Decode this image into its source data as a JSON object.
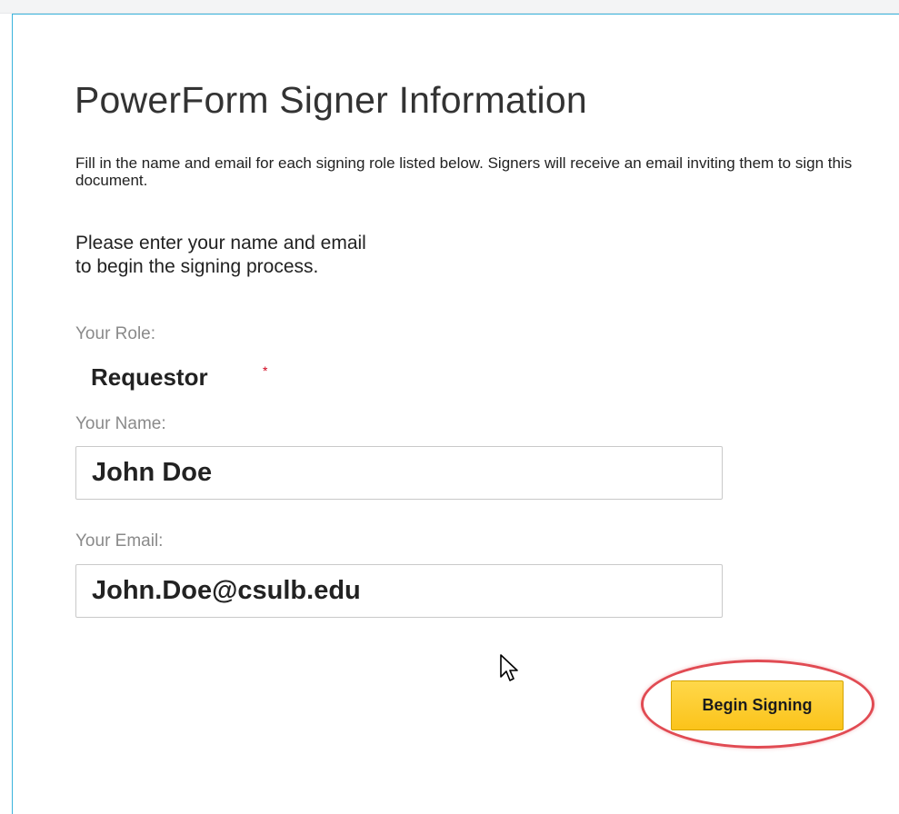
{
  "page": {
    "title": "PowerForm Signer Information",
    "intro": "Fill in the name and email for each signing role listed below. Signers will receive an email inviting them to sign this document.",
    "prompt_line1": "Please enter your name and email",
    "prompt_line2": "to begin the signing process."
  },
  "form": {
    "role_label": "Your Role:",
    "role_value": "Requestor",
    "required_mark": "*",
    "name_label": "Your Name:",
    "name_value": "John Doe",
    "email_label": "Your Email:",
    "email_value": "John.Doe@csulb.edu"
  },
  "actions": {
    "begin_label": "Begin Signing"
  },
  "colors": {
    "card_border": "#39b3dc",
    "button_fill": "#fbc31a",
    "highlight_oval": "#e14b53",
    "required_mark": "#d0021b"
  },
  "icons": {
    "cursor": "mouse-pointer-icon"
  }
}
